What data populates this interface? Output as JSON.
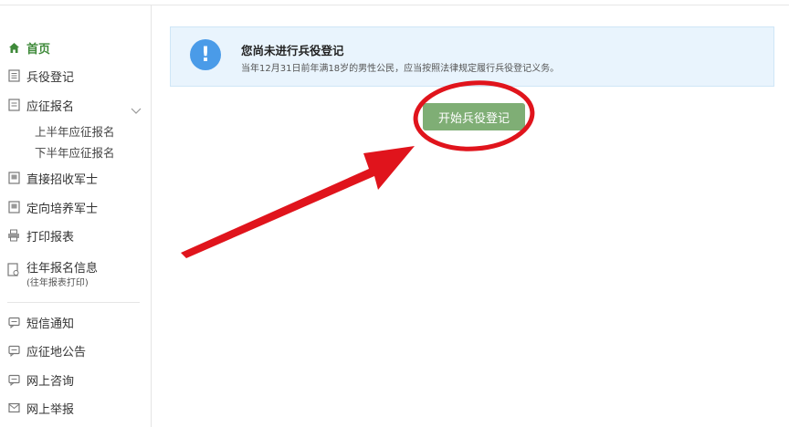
{
  "sidebar": {
    "home": "首页",
    "items": [
      {
        "label": "兵役登记",
        "icon": "document-icon"
      },
      {
        "label": "应征报名",
        "icon": "form-icon"
      },
      {
        "label": "直接招收军士",
        "icon": "id-card-icon"
      },
      {
        "label": "定向培养军士",
        "icon": "id-card-icon"
      },
      {
        "label": "打印报表",
        "icon": "printer-icon"
      }
    ],
    "sub_items": [
      "上半年应征报名",
      "下半年应征报名"
    ],
    "history": {
      "label": "往年报名信息",
      "sub": "(往年报表打印)"
    },
    "bottom_items": [
      {
        "label": "短信通知",
        "icon": "message-icon"
      },
      {
        "label": "应征地公告",
        "icon": "announcement-icon"
      },
      {
        "label": "网上咨询",
        "icon": "chat-icon"
      },
      {
        "label": "网上举报",
        "icon": "mail-icon"
      }
    ]
  },
  "alert": {
    "icon": "exclamation-icon",
    "title": "您尚未进行兵役登记",
    "description": "当年12月31日前年满18岁的男性公民，应当按照法律规定履行兵役登记义务。"
  },
  "main": {
    "start_button": "开始兵役登记"
  },
  "colors": {
    "accent_green": "#3f8a3a",
    "button_green": "#7fae75",
    "info_blue": "#4a9be8",
    "annotation_red": "#e0141c"
  }
}
